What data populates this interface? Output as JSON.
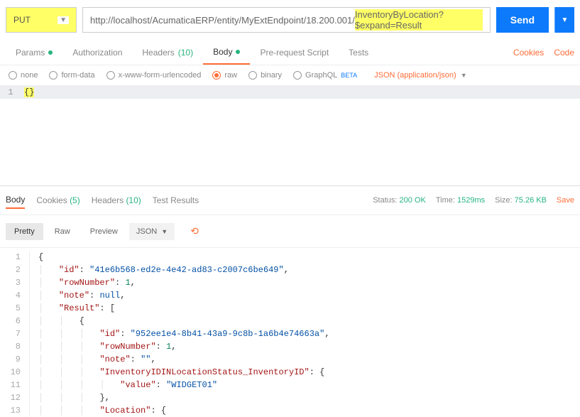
{
  "request": {
    "method": "PUT",
    "url_prefix": "http://localhost/AcumaticaERP/entity/MyExtEndpoint/18.200.001/",
    "url_highlighted": "InventoryByLocation?$expand=Result",
    "send_label": "Send"
  },
  "tabs": {
    "params": "Params",
    "authorization": "Authorization",
    "headers": "Headers",
    "headers_count": "(10)",
    "body": "Body",
    "prerequest": "Pre-request Script",
    "tests": "Tests",
    "cookies_link": "Cookies",
    "code_link": "Code"
  },
  "body_types": {
    "none": "none",
    "formdata": "form-data",
    "urlencoded": "x-www-form-urlencoded",
    "raw": "raw",
    "binary": "binary",
    "graphql": "GraphQL",
    "beta": "BETA",
    "content_type": "JSON (application/json)"
  },
  "request_body": {
    "line1": "{}"
  },
  "response_tabs": {
    "body": "Body",
    "cookies": "Cookies",
    "cookies_count": "(5)",
    "headers": "Headers",
    "headers_count": "(10)",
    "test_results": "Test Results"
  },
  "response_meta": {
    "status_label": "Status:",
    "status_value": "200 OK",
    "time_label": "Time:",
    "time_value": "1529ms",
    "size_label": "Size:",
    "size_value": "75.26 KB",
    "save": "Save"
  },
  "view": {
    "pretty": "Pretty",
    "raw": "Raw",
    "preview": "Preview",
    "format": "JSON"
  },
  "response_body": {
    "lines": [
      {
        "n": 1,
        "indent": 0,
        "html": "<span class='punct'>{</span>"
      },
      {
        "n": 2,
        "indent": 1,
        "html": "<span class='key'>\"id\"</span><span class='punct'>: </span><span class='str'>\"41e6b568-ed2e-4e42-ad83-c2007c6be649\"</span><span class='punct'>,</span>"
      },
      {
        "n": 3,
        "indent": 1,
        "html": "<span class='key'>\"rowNumber\"</span><span class='punct'>: </span><span class='num'>1</span><span class='punct'>,</span>"
      },
      {
        "n": 4,
        "indent": 1,
        "html": "<span class='key'>\"note\"</span><span class='punct'>: </span><span class='null'>null</span><span class='punct'>,</span>"
      },
      {
        "n": 5,
        "indent": 1,
        "html": "<span class='key'>\"Result\"</span><span class='punct'>: [</span>"
      },
      {
        "n": 6,
        "indent": 2,
        "html": "<span class='punct'>{</span>"
      },
      {
        "n": 7,
        "indent": 3,
        "html": "<span class='key'>\"id\"</span><span class='punct'>: </span><span class='str'>\"952ee1e4-8b41-43a9-9c8b-1a6b4e74663a\"</span><span class='punct'>,</span>"
      },
      {
        "n": 8,
        "indent": 3,
        "html": "<span class='key'>\"rowNumber\"</span><span class='punct'>: </span><span class='num'>1</span><span class='punct'>,</span>"
      },
      {
        "n": 9,
        "indent": 3,
        "html": "<span class='key'>\"note\"</span><span class='punct'>: </span><span class='str'>\"\"</span><span class='punct'>,</span>"
      },
      {
        "n": 10,
        "indent": 3,
        "html": "<span class='key'>\"InventoryIDINLocationStatus_InventoryID\"</span><span class='punct'>: {</span>"
      },
      {
        "n": 11,
        "indent": 4,
        "html": "<span class='key'>\"value\"</span><span class='punct'>: </span><span class='str'>\"WIDGET01\"</span>"
      },
      {
        "n": 12,
        "indent": 3,
        "html": "<span class='punct'>},</span>"
      },
      {
        "n": 13,
        "indent": 3,
        "html": "<span class='key'>\"Location\"</span><span class='punct'>: {</span>"
      }
    ]
  }
}
